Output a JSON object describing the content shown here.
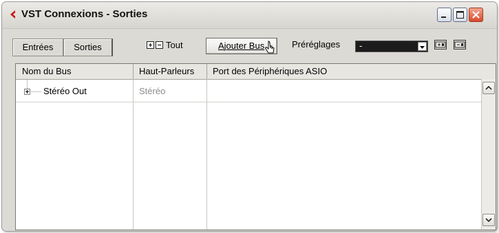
{
  "window": {
    "title": "VST Connexions - Sorties",
    "accent_color": "#c8140f"
  },
  "tabs": [
    {
      "label": "Entrées",
      "selected": false
    },
    {
      "label": "Sorties",
      "selected": true
    }
  ],
  "toolbar": {
    "tout_label": "Tout",
    "add_bus_label": "Ajouter Bus",
    "presets_label": "Préréglages",
    "preset_value": "-"
  },
  "table": {
    "headers": [
      "Nom du Bus",
      "Haut-Parleurs",
      "Port des Périphériques ASIO"
    ],
    "rows": [
      {
        "name": "Stéréo Out",
        "speakers": "Stéréo",
        "port": ""
      }
    ]
  }
}
